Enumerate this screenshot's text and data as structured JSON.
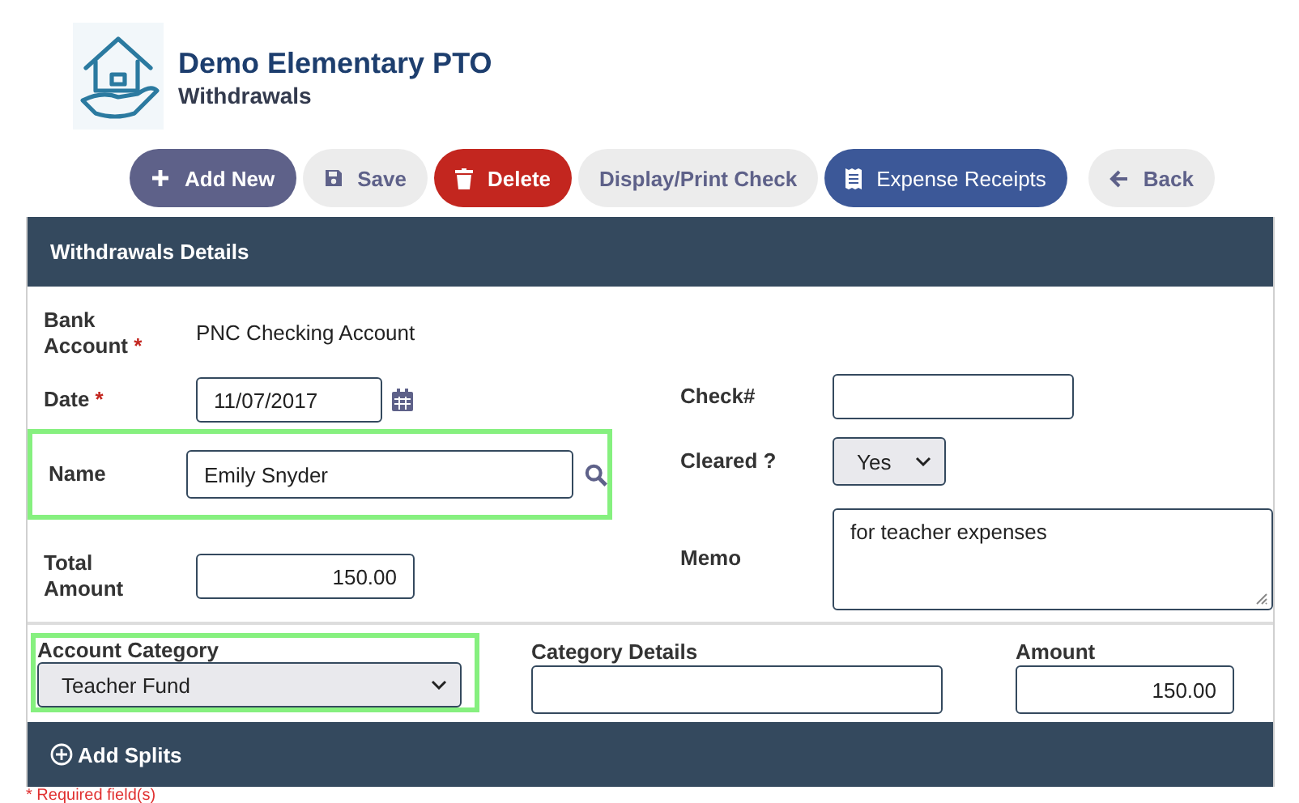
{
  "header": {
    "title": "Demo Elementary PTO",
    "subtitle": "Withdrawals"
  },
  "toolbar": [
    {
      "label": "Add New",
      "kind": "add"
    },
    {
      "label": "Save",
      "kind": "save"
    },
    {
      "label": "Delete",
      "kind": "delete"
    },
    {
      "label": "Display/Print Check",
      "kind": "plain"
    },
    {
      "label": "Expense Receipts",
      "kind": "receipts"
    },
    {
      "label": "Back",
      "kind": "back"
    }
  ],
  "panel": {
    "title": "Withdrawals Details"
  },
  "form": {
    "bank_account": {
      "label": "Bank Account",
      "required_mark": "*",
      "value": "PNC Checking Account"
    },
    "date": {
      "label": "Date",
      "required_mark": "*",
      "value": "11/07/2017"
    },
    "name": {
      "label": "Name",
      "value": "Emily Snyder",
      "highlighted": true
    },
    "total_amount": {
      "label": "Total Amount",
      "value": "150.00"
    },
    "check_number": {
      "label": "Check#"
    },
    "cleared": {
      "label": "Cleared ?",
      "value": "Yes"
    },
    "memo": {
      "label": "Memo",
      "value": "for teacher expenses"
    }
  },
  "split": {
    "account_category": {
      "label": "Account Category",
      "value": "Teacher Fund",
      "highlighted": true
    },
    "category_details": {
      "label": "Category Details"
    },
    "amount": {
      "label": "Amount",
      "value": "150.00"
    }
  },
  "add_splits": {
    "label": "Add Splits"
  },
  "required_note": "* Required field(s)"
}
